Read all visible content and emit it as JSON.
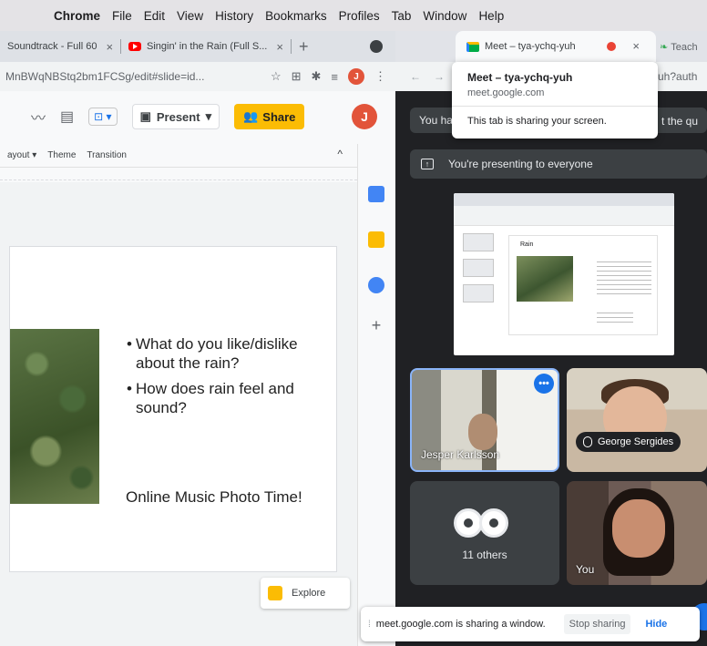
{
  "menubar": {
    "items": [
      "Chrome",
      "File",
      "Edit",
      "View",
      "History",
      "Bookmarks",
      "Profiles",
      "Tab",
      "Window",
      "Help"
    ]
  },
  "left_window": {
    "tabs": [
      {
        "label": "Soundtrack - Full 60"
      },
      {
        "label": "Singin' in the Rain (Full S..."
      }
    ],
    "address": "MnBWqNBStq2bm1FCSg/edit#slide=id...",
    "avatar_initial": "J",
    "toolbar": {
      "present_label": "Present",
      "share_label": "Share"
    },
    "menu": [
      "ayout",
      "Theme",
      "Transition"
    ],
    "slide": {
      "bullets": [
        "What do you like/dislike about the rain?",
        "How does rain feel and sound?"
      ],
      "caption": "Online Music Photo Time!"
    },
    "explore_label": "Explore"
  },
  "right_window": {
    "tab_label": "Meet – tya-ychq-yuh",
    "next_tab_label": "Teach",
    "address_tail": "yuh?auth",
    "tooltip": {
      "title": "Meet – tya-ychq-yuh",
      "domain": "meet.google.com",
      "note": "This tab is sharing your screen."
    },
    "banner_start": "You ha",
    "banner_end": "t the qu",
    "presenting_label": "You're presenting to everyone",
    "participants": [
      {
        "name": "Jesper Karlsson"
      },
      {
        "name": "George Sergides"
      },
      {
        "name": "You"
      }
    ],
    "others_label": "11 others",
    "thumb_slide_title": "Rain"
  },
  "share_bar": {
    "message": "meet.google.com is sharing a window.",
    "stop_label": "Stop sharing",
    "hide_label": "Hide"
  },
  "colors": {
    "share_yellow": "#fbbc04",
    "meet_dark": "#202124",
    "accent_blue": "#1a73e8"
  }
}
